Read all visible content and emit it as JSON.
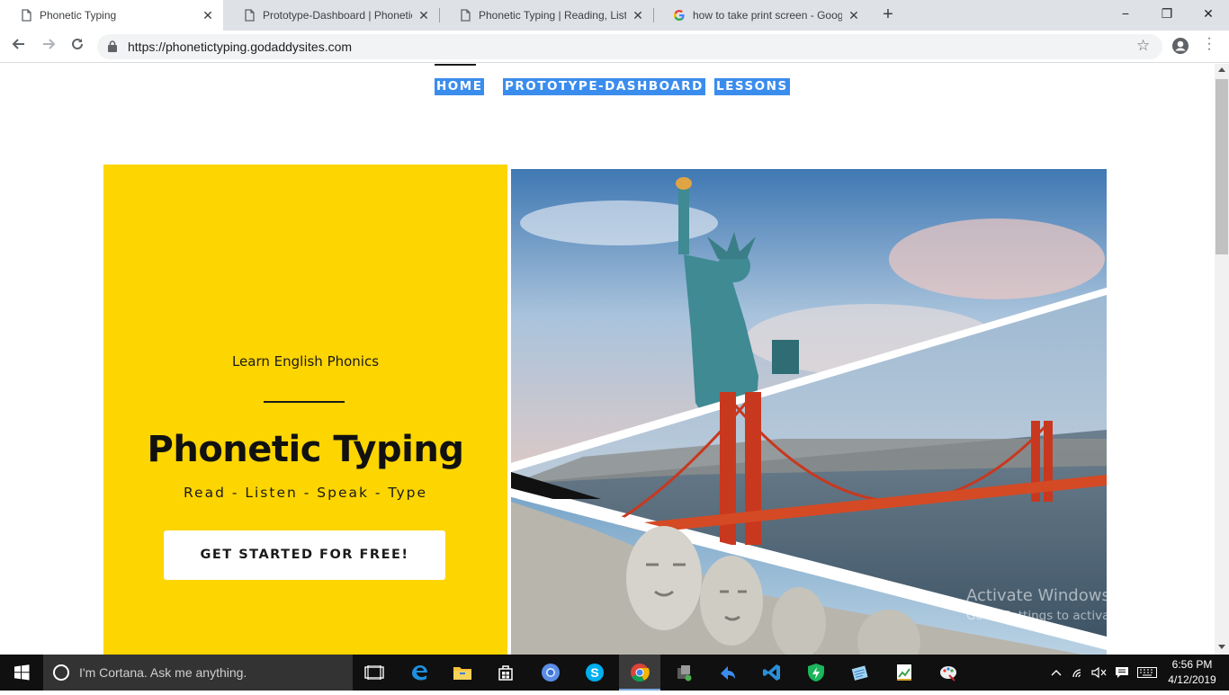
{
  "browser": {
    "tabs": [
      {
        "title": "Phonetic Typing",
        "active": true
      },
      {
        "title": "Prototype-Dashboard | Phonetic",
        "active": false
      },
      {
        "title": "Phonetic Typing | Reading, Listen",
        "active": false
      },
      {
        "title": "how to take print screen - Googl",
        "active": false
      }
    ],
    "new_tab": "+",
    "window_controls": {
      "minimize": "−",
      "maximize": "❐",
      "close": "✕"
    },
    "url": "https://phonetictyping.godaddysites.com"
  },
  "site": {
    "nav": [
      {
        "label": "HOME",
        "active": true
      },
      {
        "label": "PROTOTYPE-DASHBOARD",
        "active": false
      },
      {
        "label": "LESSONS",
        "active": false
      }
    ],
    "hero": {
      "tagline": "Learn English Phonics",
      "title": "Phonetic Typing",
      "subtitle": "Read - Listen - Speak - Type",
      "cta": "GET STARTED FOR FREE!",
      "image_alt": "Collage: Statue of Liberty, Golden Gate Bridge, Mount Rushmore"
    },
    "accent_color": "#fdd500",
    "selection_color": "#3b8ded"
  },
  "watermark": {
    "line1": "Activate Windows",
    "line2": "Go to Settings to activate Windows."
  },
  "taskbar": {
    "search_placeholder": "I'm Cortana. Ask me anything.",
    "apps": [
      "task-view-icon",
      "edge-icon",
      "file-explorer-icon",
      "store-icon",
      "chromium-icon",
      "skype-icon",
      "chrome-icon",
      "app-icon",
      "arrow-app-icon",
      "vscode-icon",
      "shield-app-icon",
      "notepad-icon",
      "spreadsheet-icon",
      "paint-icon"
    ],
    "time": "6:56 PM",
    "date": "4/12/2019"
  }
}
